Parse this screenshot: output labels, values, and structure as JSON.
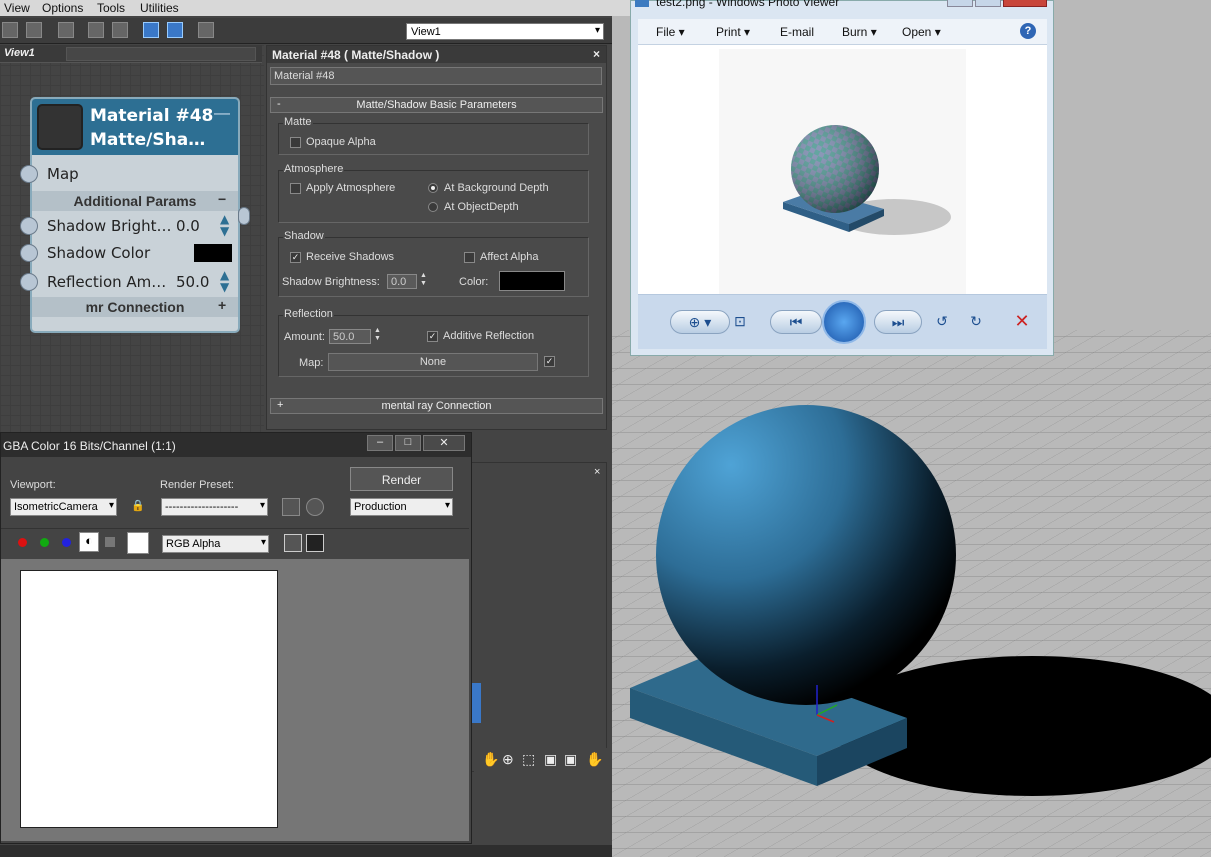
{
  "menu": [
    "View",
    "Options",
    "Tools",
    "Utilities"
  ],
  "viewport_select": "View1",
  "view_tab": "View1",
  "node": {
    "title1": "Material #48",
    "title2": "Matte/Sha…",
    "map": "Map",
    "additional": "Additional Params",
    "shadow_bright_label": "Shadow  Bright…",
    "shadow_bright_val": "0.0",
    "shadow_color": "Shadow Color",
    "reflection_label": "Reflection  Am…",
    "reflection_val": "50.0",
    "mr": "mr Connection"
  },
  "material": {
    "header": "Material #48  ( Matte/Shadow )",
    "name": "Material #48",
    "rollout": "Matte/Shadow Basic Parameters",
    "matte": "Matte",
    "opaque_alpha": "Opaque Alpha",
    "atmosphere": "Atmosphere",
    "apply_atmosphere": "Apply Atmosphere",
    "at_bg_depth": "At Background Depth",
    "at_obj_depth": "At ObjectDepth",
    "shadow": "Shadow",
    "receive_shadows": "Receive Shadows",
    "affect_alpha": "Affect Alpha",
    "shadow_brightness": "Shadow Brightness:",
    "shadow_brightness_val": "0.0",
    "color": "Color:",
    "reflection": "Reflection",
    "amount": "Amount:",
    "amount_val": "50.0",
    "additive_reflection": "Additive Reflection",
    "map": "Map:",
    "none": "None",
    "mr_connection": "mental ray Connection",
    "collapse": "-",
    "expand": "+"
  },
  "render": {
    "title": "GBA Color 16 Bits/Channel (1:1)",
    "viewport_label": "Viewport:",
    "viewport_val": "IsometricCamera",
    "preset_label": "Render Preset:",
    "preset_val": "--------------------",
    "render_btn": "Render",
    "production": "Production",
    "channel": "RGB Alpha"
  },
  "photoviewer": {
    "title": "test2.png - Windows Photo Viewer",
    "menu": [
      "File",
      "Print",
      "E-mail",
      "Burn",
      "Open"
    ]
  },
  "colors": {
    "node_header": "#2d6f93",
    "sphere": "#3a7ca6",
    "accent": "#3a78c8"
  }
}
